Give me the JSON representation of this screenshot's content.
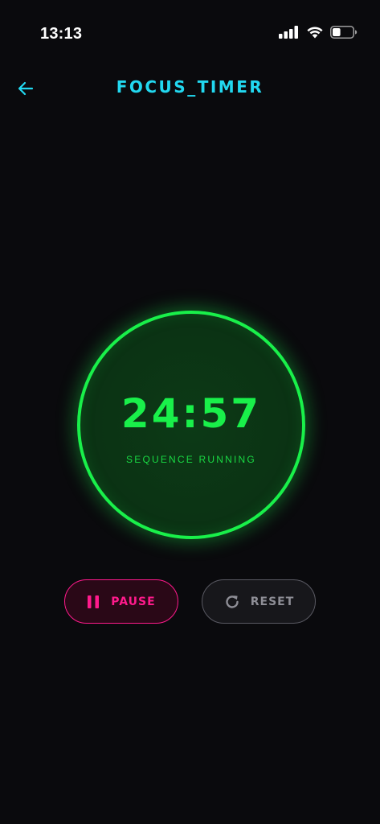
{
  "status_bar": {
    "time": "13:13",
    "icons": [
      "signal-icon",
      "wifi-icon",
      "battery-icon"
    ],
    "battery_level": 0.4
  },
  "header": {
    "title": "FOCUS_TIMER",
    "back_icon": "arrow-left-icon"
  },
  "timer": {
    "value": "24:57",
    "status": "SEQUENCE RUNNING",
    "ring_color": "#19f04a"
  },
  "controls": {
    "pause": {
      "label": "PAUSE",
      "icon": "pause-icon",
      "color": "#ff1a8c"
    },
    "reset": {
      "label": "RESET",
      "icon": "refresh-icon",
      "color": "#8e8e96"
    }
  },
  "colors": {
    "background": "#0a0a0d",
    "accent_cyan": "#22d8f0",
    "accent_green": "#19f04a",
    "accent_pink": "#ff1a8c"
  }
}
